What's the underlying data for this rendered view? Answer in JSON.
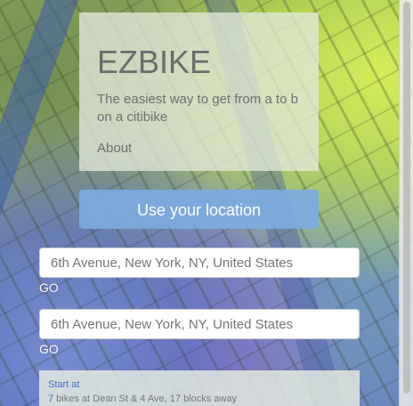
{
  "header": {
    "title": "EZBIKE",
    "tagline": "The easiest way to get from a to b on a citibike",
    "about_label": "About"
  },
  "location_button": {
    "label": "Use your location"
  },
  "start": {
    "placeholder": "6th Avenue, New York, NY, United States",
    "go_label": "GO"
  },
  "end": {
    "placeholder": "6th Avenue, New York, NY, United States",
    "go_label": "GO"
  },
  "results": {
    "heading": "Start at",
    "bike_count": "7",
    "detail": " bikes at Dean St & 4 Ave, 17 blocks away"
  },
  "colors": {
    "accent_button": "#7daae1",
    "link": "#3a6fd0"
  }
}
